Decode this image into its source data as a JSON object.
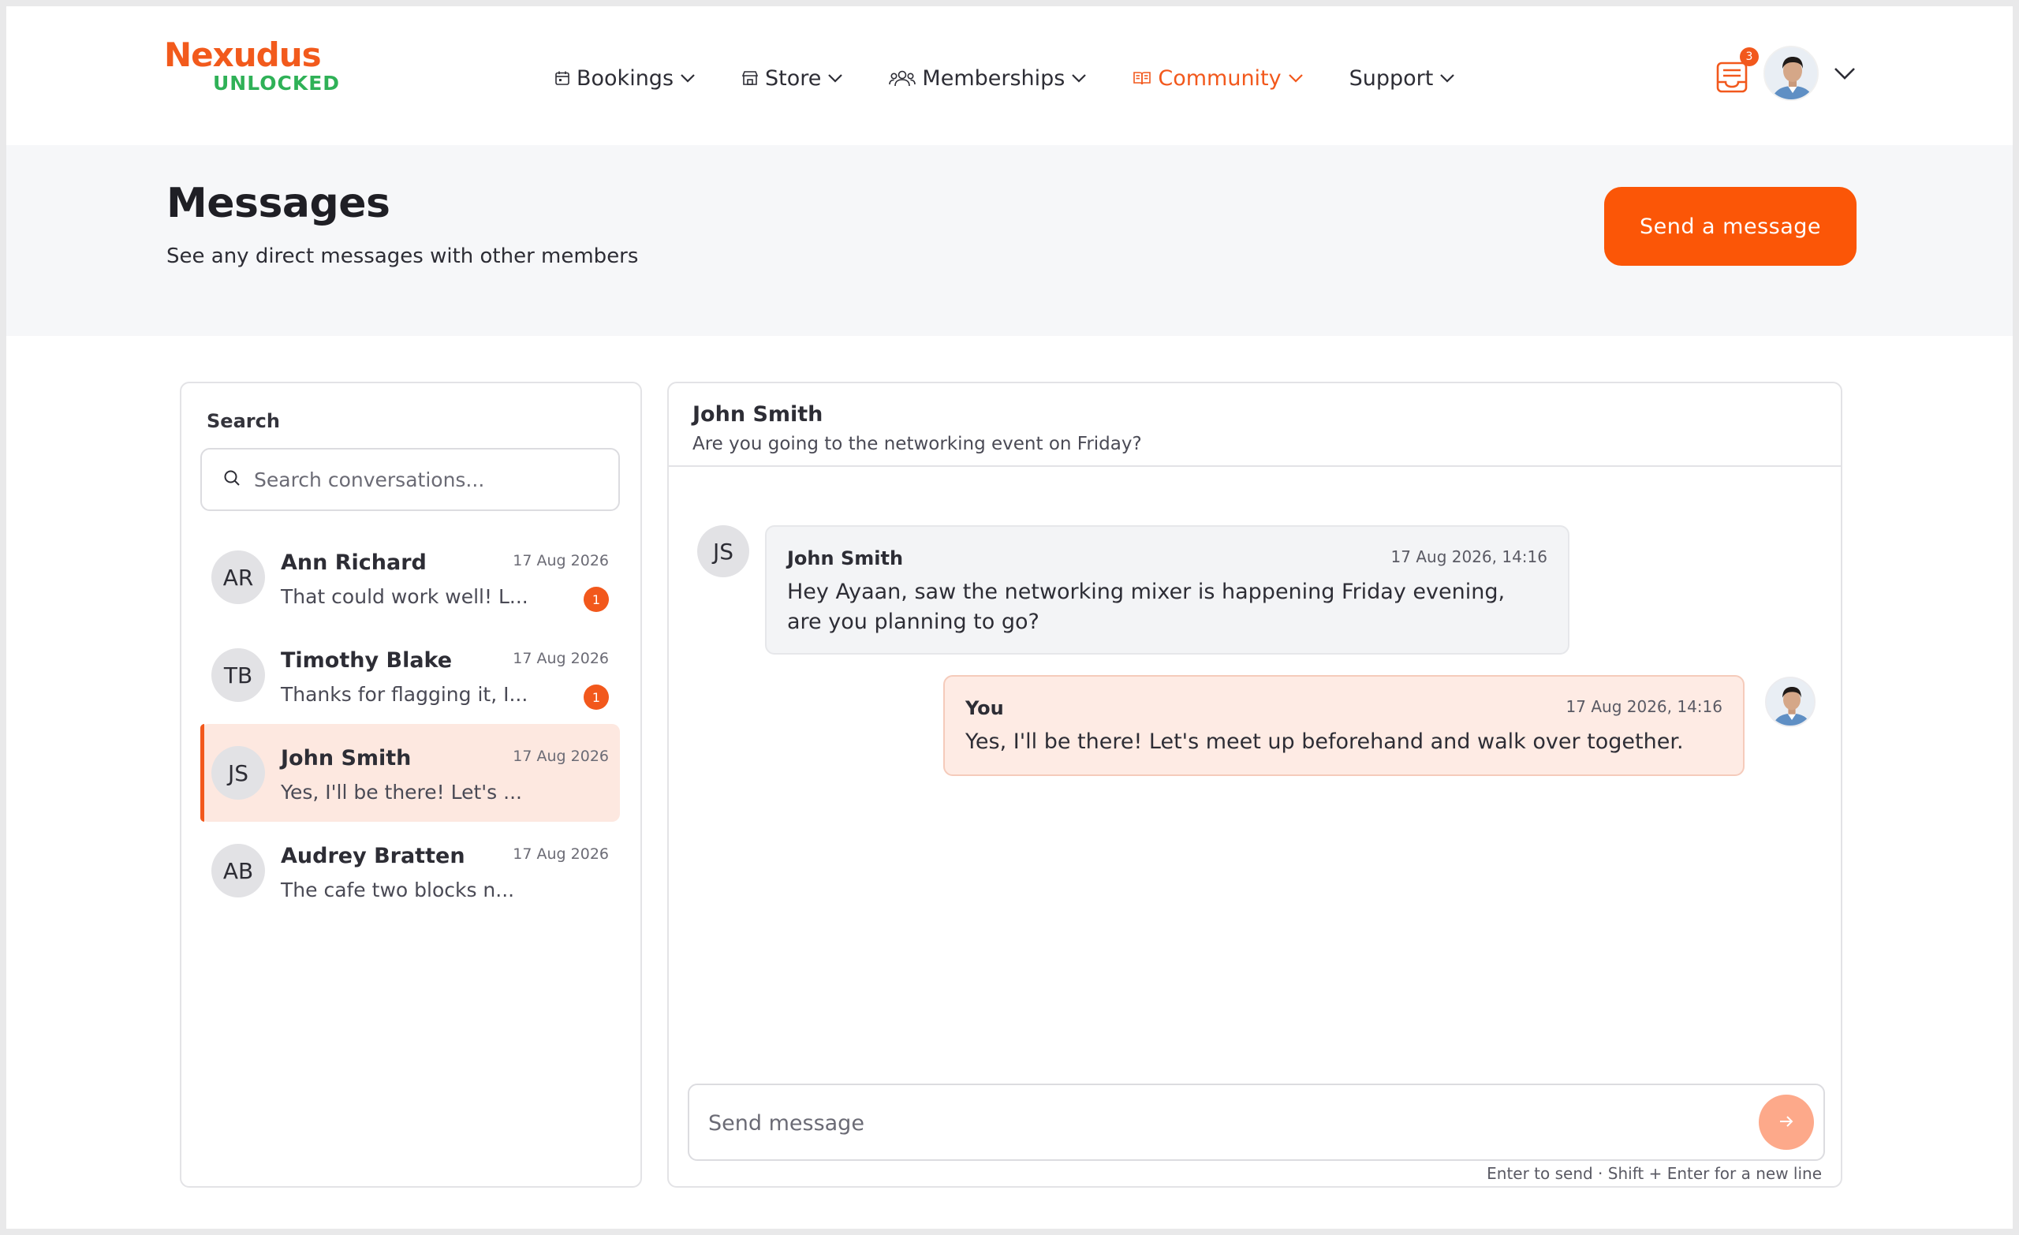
{
  "brand": {
    "name": "Nexudus",
    "tagline": "UNLOCKED",
    "primary_color": "#fb5607",
    "accent_color": "#2fb157"
  },
  "nav": {
    "items": [
      {
        "label": "Bookings",
        "icon": "calendar-icon",
        "active": false
      },
      {
        "label": "Store",
        "icon": "store-icon",
        "active": false
      },
      {
        "label": "Memberships",
        "icon": "users-icon",
        "active": false
      },
      {
        "label": "Community",
        "icon": "book-icon",
        "active": true
      },
      {
        "label": "Support",
        "icon": "",
        "active": false
      }
    ]
  },
  "header": {
    "notification_count": "3",
    "notification_icon": "inbox-icon",
    "user_menu_icon": "chevron-down-icon"
  },
  "page": {
    "title": "Messages",
    "subtitle": "See any direct messages with other members",
    "send_button_label": "Send a message"
  },
  "search": {
    "label": "Search",
    "placeholder": "Search conversations..."
  },
  "conversations": [
    {
      "initials": "AR",
      "name": "Ann Richard",
      "date": "17 Aug 2026",
      "preview": "That could work well! L...",
      "unread": "1",
      "selected": false
    },
    {
      "initials": "TB",
      "name": "Timothy Blake",
      "date": "17 Aug 2026",
      "preview": "Thanks for flagging it, I...",
      "unread": "1",
      "selected": false
    },
    {
      "initials": "JS",
      "name": "John Smith",
      "date": "17 Aug 2026",
      "preview": "Yes, I'll be there! Let's ...",
      "unread": "",
      "selected": true
    },
    {
      "initials": "AB",
      "name": "Audrey Bratten",
      "date": "17 Aug 2026",
      "preview": "The cafe two blocks n...",
      "unread": "",
      "selected": false
    }
  ],
  "chat": {
    "name": "John Smith",
    "preview": "Are you going to the networking event on Friday?",
    "messages": [
      {
        "initials": "JS",
        "sender": "John Smith",
        "time": "17 Aug 2026, 14:16",
        "text": "Hey Ayaan, saw the networking mixer is happening Friday evening, are you planning to go?"
      },
      {
        "sender": "You",
        "time": "17 Aug 2026, 14:16",
        "text": "Yes, I'll be there! Let's meet up beforehand and walk over together."
      }
    ],
    "composer_placeholder": "Send message",
    "composer_hint": "Enter to send · Shift + Enter for a new line",
    "send_icon": "arrow-right-icon"
  }
}
